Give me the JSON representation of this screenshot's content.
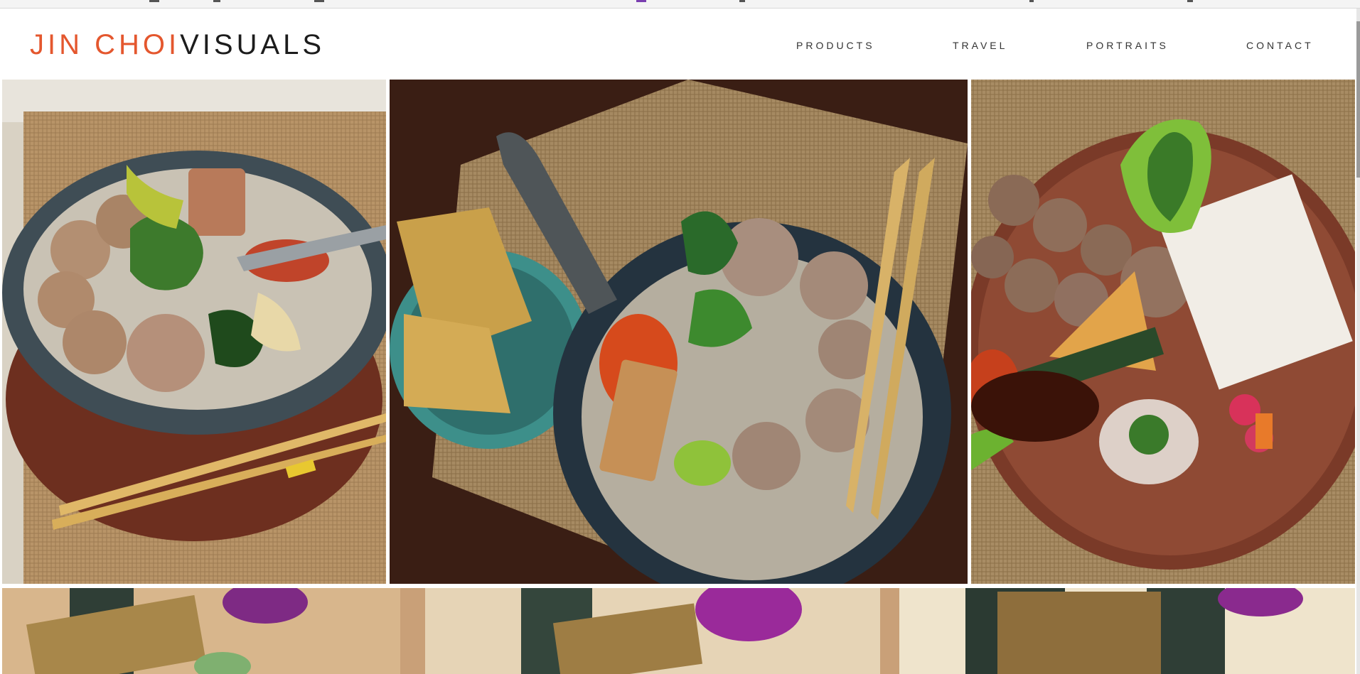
{
  "brand": {
    "name_first": "JIN CHOI",
    "name_second": "VISUALS",
    "accent_color": "#e4572e",
    "dark_color": "#1c1c1c"
  },
  "nav": {
    "items": [
      "PRODUCTS",
      "TRAVEL",
      "PORTRAITS",
      "CONTACT"
    ]
  },
  "gallery": {
    "photos": [
      {
        "alt": "Meatball soup bowl with chopsticks on burlap"
      },
      {
        "alt": "Meatball soup bowl with spoon of sambal and crackers"
      },
      {
        "alt": "Meatballs, rice cake and tofu on clay plate"
      },
      {
        "alt": "Layered cake slices on wooden boards with orchids"
      }
    ]
  }
}
